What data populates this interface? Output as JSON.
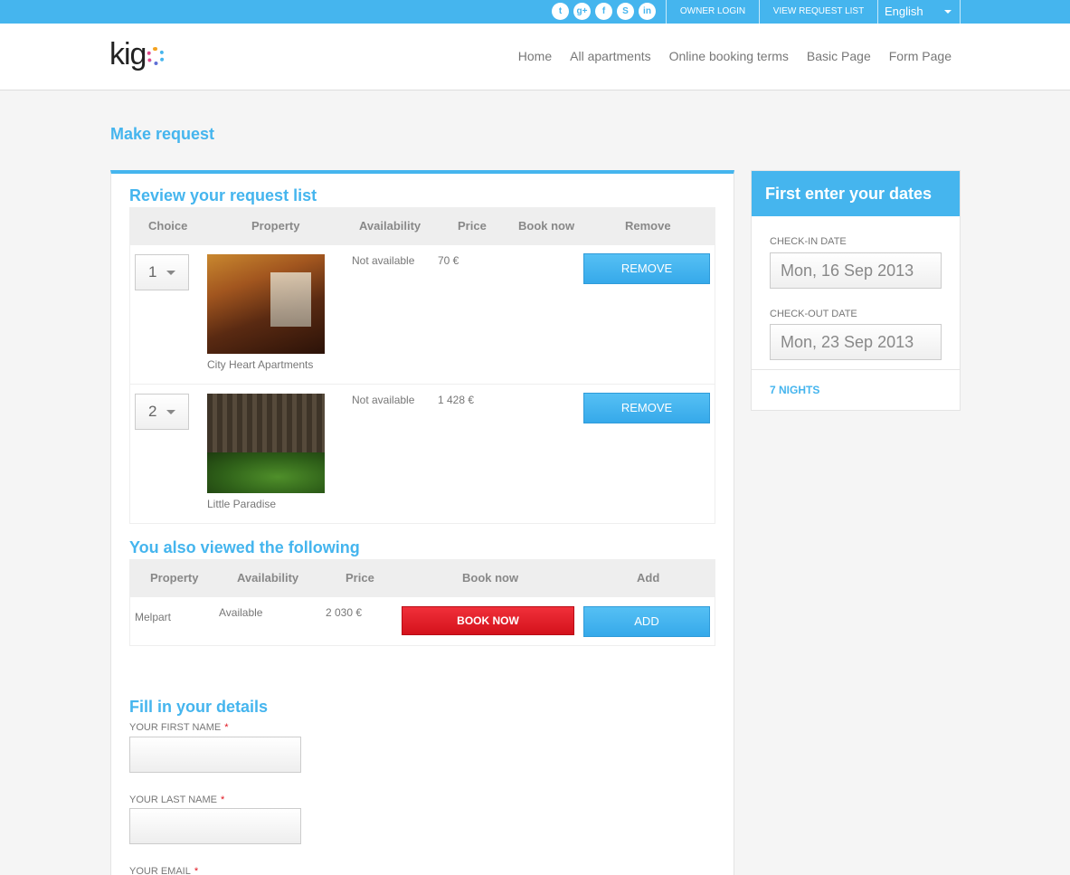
{
  "topbar": {
    "social": [
      {
        "icon": "twitter-icon",
        "glyph": "t"
      },
      {
        "icon": "google-plus-icon",
        "glyph": "g+"
      },
      {
        "icon": "facebook-icon",
        "glyph": "f"
      },
      {
        "icon": "skype-icon",
        "glyph": "S"
      },
      {
        "icon": "linkedin-icon",
        "glyph": "in"
      }
    ],
    "owner_login": "OWNER LOGIN",
    "view_request_list": "VIEW REQUEST LIST",
    "language": "English"
  },
  "header": {
    "logo_text": "kig",
    "nav": [
      "Home",
      "All apartments",
      "Online booking terms",
      "Basic Page",
      "Form Page"
    ]
  },
  "page_title": "Make request",
  "request_list": {
    "title": "Review your request list",
    "columns": [
      "Choice",
      "Property",
      "Availability",
      "Price",
      "Book now",
      "Remove"
    ],
    "rows": [
      {
        "choice": "1",
        "property": "City Heart Apartments",
        "availability": "Not available",
        "price": "70 €",
        "remove_label": "REMOVE"
      },
      {
        "choice": "2",
        "property": "Little Paradise",
        "availability": "Not available",
        "price": "1 428 €",
        "remove_label": "REMOVE"
      }
    ]
  },
  "also_viewed": {
    "title": "You also viewed the following",
    "columns": [
      "Property",
      "Availability",
      "Price",
      "Book now",
      "Add"
    ],
    "rows": [
      {
        "property": "Melpart",
        "availability": "Available",
        "price": "2 030 €",
        "book_label": "BOOK NOW",
        "add_label": "ADD"
      }
    ]
  },
  "details": {
    "title": "Fill in your details",
    "fields": [
      {
        "label": "YOUR FIRST NAME",
        "required": "*"
      },
      {
        "label": "YOUR LAST NAME",
        "required": "*"
      },
      {
        "label": "YOUR EMAIL",
        "required": "*"
      }
    ]
  },
  "sidebar": {
    "title": "First enter your dates",
    "checkin_label": "CHECK-IN DATE",
    "checkin_value": "Mon, 16 Sep 2013",
    "checkout_label": "CHECK-OUT DATE",
    "checkout_value": "Mon, 23 Sep 2013",
    "nights": "7 NIGHTS"
  },
  "colors": {
    "accent": "#45b5ee",
    "book_red": "#e0141e"
  }
}
